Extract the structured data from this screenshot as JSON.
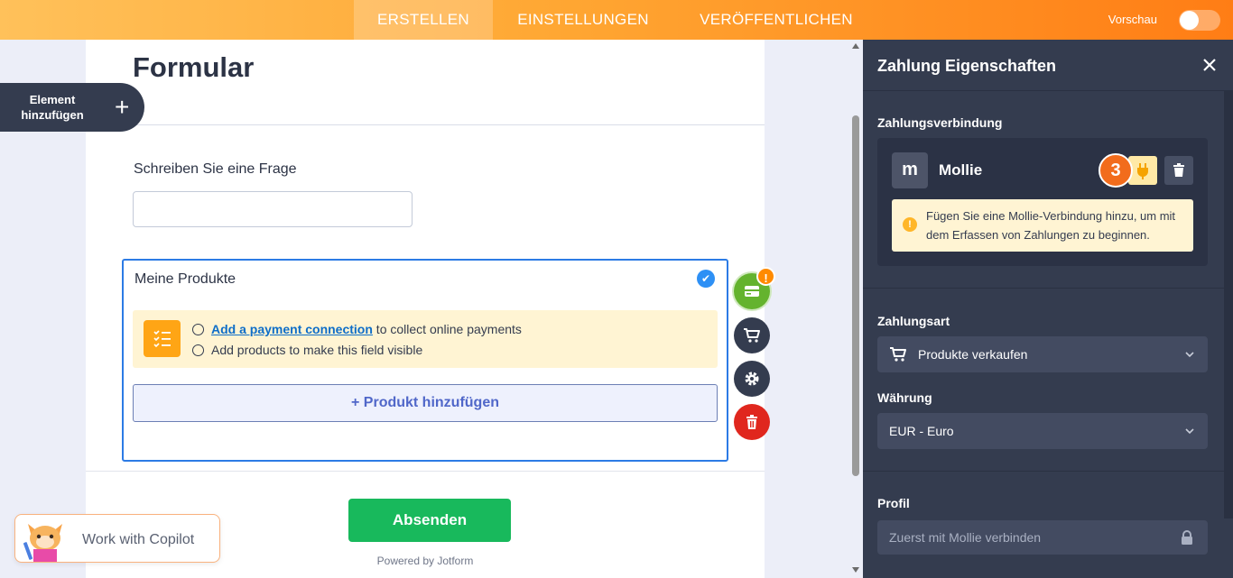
{
  "nav": {
    "tabs": [
      {
        "label": "ERSTELLEN",
        "active": true
      },
      {
        "label": "EINSTELLUNGEN",
        "active": false
      },
      {
        "label": "VERÖFFENTLICHEN",
        "active": false
      }
    ],
    "preview_label": "Vorschau",
    "preview_on": false
  },
  "add_element": {
    "label": "Element hinzufügen"
  },
  "form": {
    "title": "Formular",
    "question_label": "Schreiben Sie eine Frage",
    "question_value": "",
    "product_field": {
      "label": "Meine Produkte",
      "notice_link": "Add a payment connection",
      "notice_line1_rest": " to collect online payments",
      "notice_line2": "Add products to make this field visible",
      "add_product_label": "+ Produkt hinzufügen"
    },
    "submit_label": "Absenden",
    "powered_by": "Powered by Jotform",
    "side_actions": [
      "payment-icon",
      "cart-icon",
      "gear-icon",
      "trash-icon"
    ],
    "warning_badge": "!"
  },
  "copilot": {
    "label": "Work with Copilot"
  },
  "panel": {
    "title": "Zahlung Eigenschaften",
    "connection_section": "Zahlungsverbindung",
    "provider_logo": "m",
    "provider_name": "Mollie",
    "step_badge": "3",
    "warning_text": "Fügen Sie eine Mollie-Verbindung hinzu, um mit dem Erfassen von Zahlungen zu beginnen.",
    "payment_type_label": "Zahlungsart",
    "payment_type_value": "Produkte verkaufen",
    "currency_label": "Währung",
    "currency_value": "EUR - Euro",
    "profile_label": "Profil",
    "profile_placeholder": "Zuerst mit Mollie verbinden"
  },
  "colors": {
    "accent_orange": "#ff8a1f",
    "panel_bg": "#343c4f",
    "submit_green": "#18b95c",
    "link_blue": "#0e6ec8"
  }
}
